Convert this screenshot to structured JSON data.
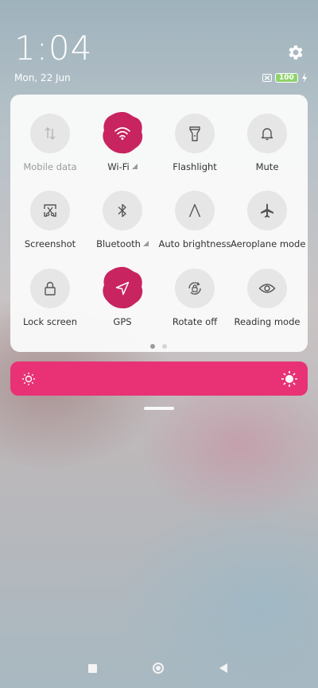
{
  "status": {
    "time": "1:04",
    "date": "Mon, 22 Jun",
    "battery_level": "100"
  },
  "tiles": [
    {
      "label": "Mobile data",
      "icon": "mobile-data-icon",
      "active": false,
      "dim": true
    },
    {
      "label": "Wi-Fi",
      "icon": "wifi-icon",
      "active": true,
      "expand": true
    },
    {
      "label": "Flashlight",
      "icon": "flashlight-icon",
      "active": false
    },
    {
      "label": "Mute",
      "icon": "bell-icon",
      "active": false
    },
    {
      "label": "Screenshot",
      "icon": "screenshot-icon",
      "active": false
    },
    {
      "label": "Bluetooth",
      "icon": "bluetooth-icon",
      "active": false,
      "expand": true
    },
    {
      "label": "Auto brightness",
      "icon": "auto-brightness-icon",
      "active": false
    },
    {
      "label": "Aeroplane mode",
      "icon": "airplane-icon",
      "active": false
    },
    {
      "label": "Lock screen",
      "icon": "lock-icon",
      "active": false
    },
    {
      "label": "GPS",
      "icon": "gps-icon",
      "active": true
    },
    {
      "label": "Rotate off",
      "icon": "rotate-lock-icon",
      "active": false
    },
    {
      "label": "Reading mode",
      "icon": "eye-icon",
      "active": false
    }
  ],
  "pager": {
    "current": 1,
    "total": 2
  },
  "brightness": {
    "level_fraction": 1.0,
    "color": "#e83275"
  },
  "colors": {
    "accent": "#e83275",
    "tile_active": "#c8245f",
    "tile_inactive": "#e6e6e6"
  }
}
